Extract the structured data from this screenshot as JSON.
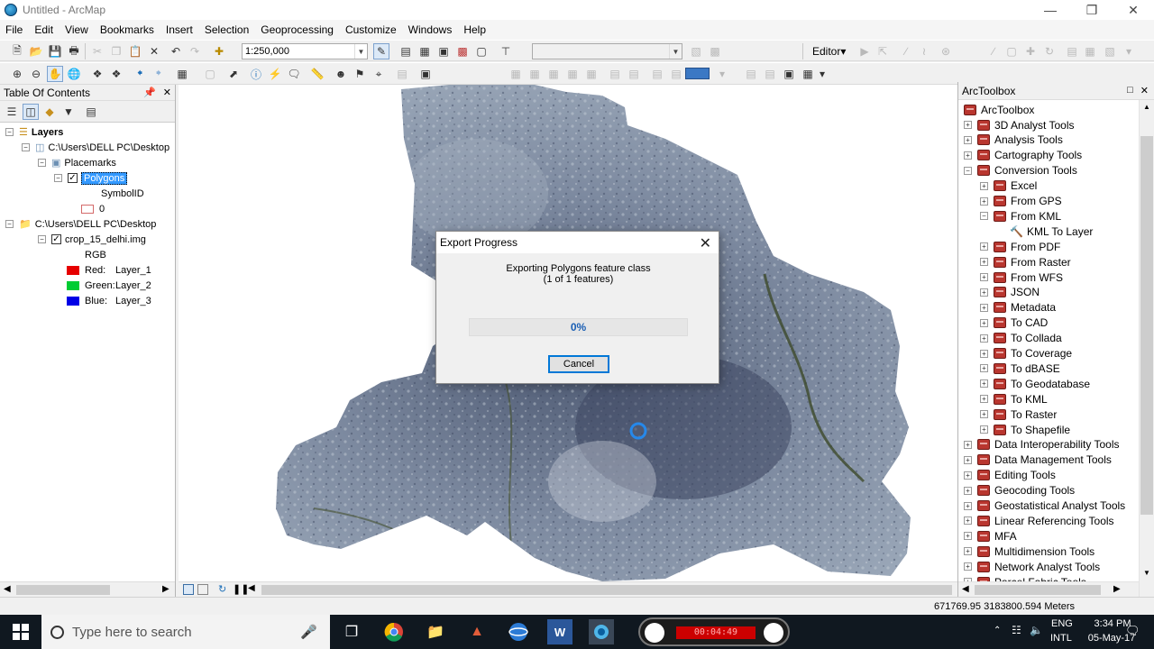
{
  "window": {
    "title": "Untitled - ArcMap",
    "controls": [
      "—",
      "❐",
      "✕"
    ]
  },
  "menu": [
    "File",
    "Edit",
    "View",
    "Bookmarks",
    "Insert",
    "Selection",
    "Geoprocessing",
    "Customize",
    "Windows",
    "Help"
  ],
  "toolbar": {
    "scale": "1:250,000",
    "editor_label": "Editor▾"
  },
  "toc": {
    "title": "Table Of Contents",
    "layers_root": "Layers",
    "items": [
      {
        "label": "C:\\Users\\DELL PC\\Desktop"
      },
      {
        "label": "Placemarks"
      },
      {
        "label": "Polygons"
      },
      {
        "label": "SymbolID"
      },
      {
        "label": "0"
      },
      {
        "label": "C:\\Users\\DELL PC\\Desktop"
      },
      {
        "label": "crop_15_delhi.img"
      },
      {
        "label": "RGB"
      }
    ],
    "bands": [
      {
        "label": "Red:",
        "layer": "Layer_1",
        "color": "#e60000"
      },
      {
        "label": "Green:",
        "layer": "Layer_2",
        "color": "#00cc33"
      },
      {
        "label": "Blue:",
        "layer": "Layer_3",
        "color": "#0000e6"
      }
    ]
  },
  "toolbox": {
    "title": "ArcToolbox",
    "root": "ArcToolbox",
    "items": [
      "3D Analyst Tools",
      "Analysis Tools",
      "Cartography Tools",
      "Conversion Tools",
      "Excel",
      "From GPS",
      "From KML",
      "KML To Layer",
      "From PDF",
      "From Raster",
      "From WFS",
      "JSON",
      "Metadata",
      "To CAD",
      "To Collada",
      "To Coverage",
      "To dBASE",
      "To Geodatabase",
      "To KML",
      "To Raster",
      "To Shapefile",
      "Data Interoperability Tools",
      "Data Management Tools",
      "Editing Tools",
      "Geocoding Tools",
      "Geostatistical Analyst Tools",
      "Linear Referencing Tools",
      "MFA",
      "Multidimension Tools",
      "Network Analyst Tools",
      "Parcel Fabric Tools"
    ]
  },
  "dialog": {
    "title": "Export Progress",
    "message_line1": "Exporting Polygons feature class",
    "message_line2": "(1 of 1 features)",
    "progress": 0,
    "progress_label": "0%",
    "cancel_label": "Cancel"
  },
  "status": {
    "coordinates": "671769.95  3183800.594 Meters"
  },
  "taskbar": {
    "search_placeholder": "Type here to search",
    "recorder_time": "00:04:49",
    "language": "ENG",
    "keyboard": "INTL",
    "time": "3:34 PM",
    "date": "05-May-17"
  }
}
